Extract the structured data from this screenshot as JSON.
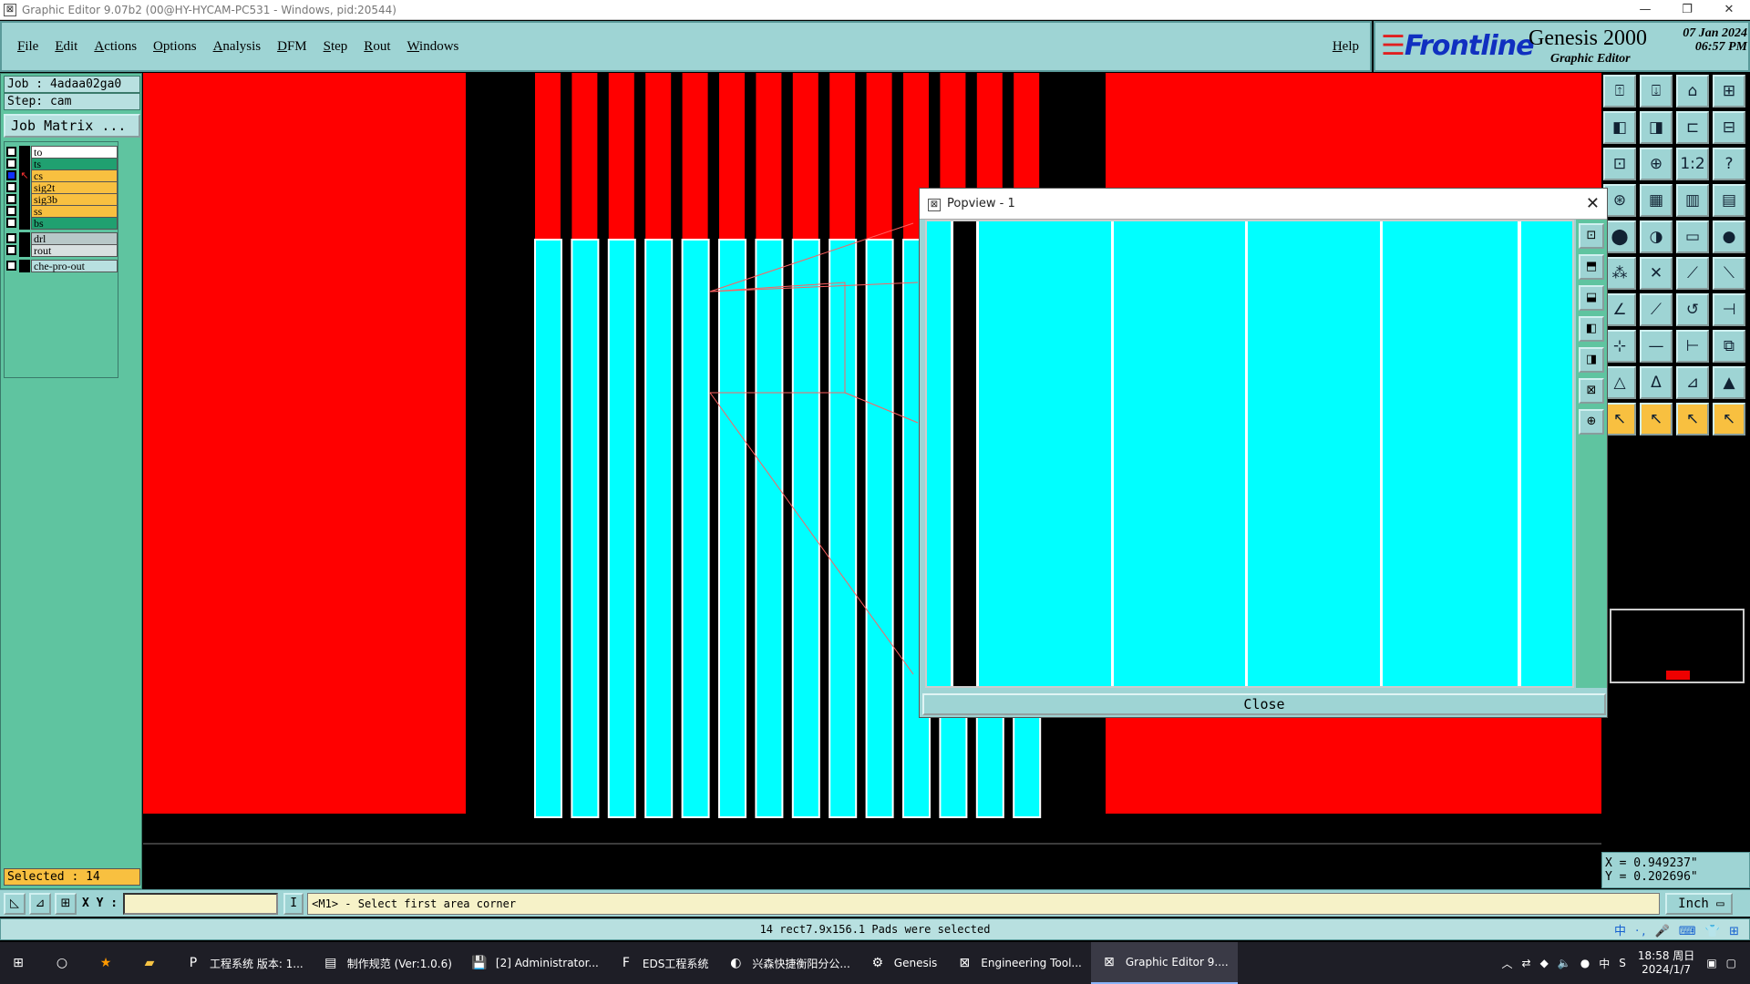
{
  "window": {
    "title": "Graphic Editor 9.07b2 (00@HY-HYCAM-PC531 - Windows, pid:20544)",
    "minimize": "—",
    "restore": "❐",
    "close": "✕"
  },
  "menu": [
    "File",
    "Edit",
    "Actions",
    "Options",
    "Analysis",
    "DFM",
    "Step",
    "Rout",
    "Windows"
  ],
  "help_label": "Help",
  "brand": {
    "logo": "Frontline",
    "product": "Genesis 2000",
    "subtitle": "Graphic Editor",
    "date_line1": "07 Jan 2024",
    "date_line2": "06:57 PM"
  },
  "job": {
    "job_line": "Job : 4adaa02ga0",
    "step_line": "Step: cam",
    "matrix_button": "Job Matrix ..."
  },
  "layers": [
    {
      "name": "to",
      "color": "#ffffff",
      "checked": false,
      "work": false
    },
    {
      "name": "ts",
      "color": "#20a070",
      "checked": false,
      "work": false
    },
    {
      "name": "cs",
      "color": "#f8c040",
      "checked": true,
      "work": true
    },
    {
      "name": "sig2t",
      "color": "#f8c040",
      "checked": false,
      "work": false
    },
    {
      "name": "sig3b",
      "color": "#f8c040",
      "checked": false,
      "work": false
    },
    {
      "name": "ss",
      "color": "#f8c040",
      "checked": false,
      "work": false
    },
    {
      "name": "bs",
      "color": "#20a070",
      "checked": false,
      "work": false
    },
    {
      "name": "drl",
      "color": "#b8c8c8",
      "checked": false,
      "work": false
    },
    {
      "name": "rout",
      "color": "#d8e0e0",
      "checked": false,
      "work": false
    },
    {
      "name": "che-pro-out",
      "color": "#b8e0e0",
      "checked": false,
      "work": false
    }
  ],
  "selected_count": "Selected : 14",
  "colors": {
    "copper": "#ff0000",
    "pad": "#00ffff",
    "background": "#000000",
    "panel": "#9ed4d4"
  },
  "popview": {
    "title": "Popview - 1",
    "close_label": "Close"
  },
  "coords": {
    "x": "X = 0.949237\"",
    "y": "Y = 0.202696\""
  },
  "status": {
    "xy_label": "X Y :",
    "xy_value": "",
    "cursor_label": "I",
    "prompt": "<M1> - Select first area corner",
    "unit": "Inch"
  },
  "message": "14 rect7.9x156.1 Pads were selected",
  "ime": "中 ·, 🎤 ⌨ 👕 ⊞",
  "taskbar": {
    "items": [
      {
        "label": "工程系统  版本: 1...",
        "icon": "P"
      },
      {
        "label": "制作规范 (Ver:1.0.6)",
        "icon": "▤"
      },
      {
        "label": "[2] Administrator...",
        "icon": "💾"
      },
      {
        "label": "EDS工程系统",
        "icon": "F"
      },
      {
        "label": "兴森快捷衡阳分公...",
        "icon": "◐"
      },
      {
        "label": "Genesis",
        "icon": "⚙"
      },
      {
        "label": "Engineering Tool...",
        "icon": "⊠"
      },
      {
        "label": "Graphic Editor 9....",
        "icon": "⊠"
      }
    ],
    "clock_time": "18:58 周日",
    "clock_date": "2024/1/7"
  }
}
